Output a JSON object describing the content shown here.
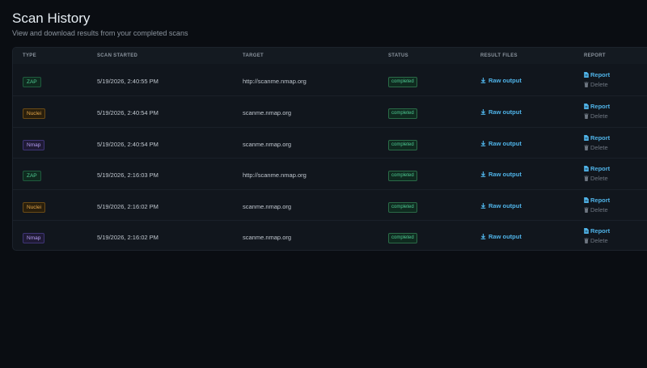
{
  "header": {
    "title": "Scan History",
    "subtitle": "View and download results from your completed scans"
  },
  "table": {
    "columns": [
      "TYPE",
      "SCAN STARTED",
      "TARGET",
      "STATUS",
      "RESULT FILES",
      "REPORT"
    ],
    "rows": [
      {
        "type": "ZAP",
        "started": "5/19/2026, 2:40:55 PM",
        "target": "http://scanme.nmap.org",
        "status": "completed",
        "files": "Raw output",
        "report": "Report",
        "delete": "Delete"
      },
      {
        "type": "Nuclei",
        "started": "5/19/2026, 2:40:54 PM",
        "target": "scanme.nmap.org",
        "status": "completed",
        "files": "Raw output",
        "report": "Report",
        "delete": "Delete"
      },
      {
        "type": "Nmap",
        "started": "5/19/2026, 2:40:54 PM",
        "target": "scanme.nmap.org",
        "status": "completed",
        "files": "Raw output",
        "report": "Report",
        "delete": "Delete"
      },
      {
        "type": "ZAP",
        "started": "5/19/2026, 2:16:03 PM",
        "target": "http://scanme.nmap.org",
        "status": "completed",
        "files": "Raw output",
        "report": "Report",
        "delete": "Delete"
      },
      {
        "type": "Nuclei",
        "started": "5/19/2026, 2:16:02 PM",
        "target": "scanme.nmap.org",
        "status": "completed",
        "files": "Raw output",
        "report": "Report",
        "delete": "Delete"
      },
      {
        "type": "Nmap",
        "started": "5/19/2026, 2:16:02 PM",
        "target": "scanme.nmap.org",
        "status": "completed",
        "files": "Raw output",
        "report": "Report",
        "delete": "Delete"
      }
    ]
  },
  "icons": {
    "download": "download-icon",
    "report": "file-icon",
    "delete": "trash-icon"
  },
  "colors": {
    "background": "#0a0d12",
    "card": "#11161d",
    "link": "#4fb3e8",
    "zap": "#4ec993",
    "nuclei": "#e3a64a",
    "nmap": "#b39cf0",
    "status_completed": "#4ec993"
  }
}
